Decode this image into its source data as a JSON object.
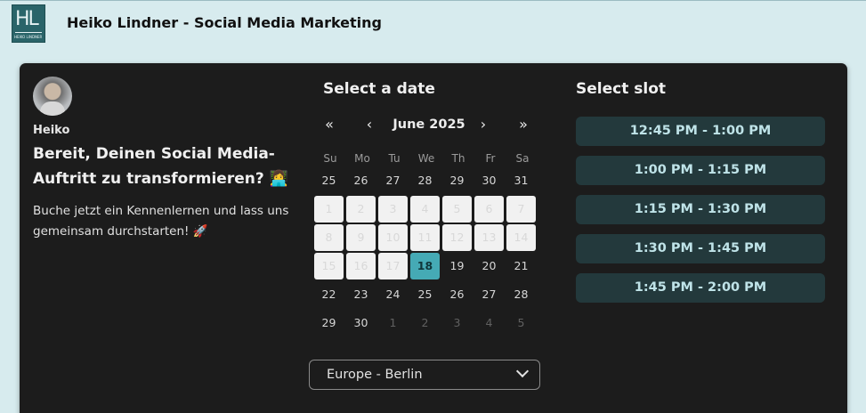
{
  "header": {
    "logo_letters": "HL",
    "logo_sub": "HEIKO LINDNER",
    "brand": "Heiko Lindner - Social Media Marketing"
  },
  "host": {
    "name": "Heiko",
    "title": "Bereit, Deinen Social Media-Auftritt zu transformieren? 👩‍💻",
    "description": "Buche jetzt ein Kennenlernen und lass uns gemeinsam durchstarten! 🚀"
  },
  "calendar": {
    "heading": "Select a date",
    "nav": {
      "prev_year": "«",
      "prev_month": "‹",
      "next_month": "›",
      "next_year": "»"
    },
    "month_label": "June 2025",
    "weekdays": [
      "Su",
      "Mo",
      "Tu",
      "We",
      "Th",
      "Fr",
      "Sa"
    ],
    "weeks": [
      [
        {
          "d": "25",
          "s": "normal"
        },
        {
          "d": "26",
          "s": "normal"
        },
        {
          "d": "27",
          "s": "normal"
        },
        {
          "d": "28",
          "s": "normal"
        },
        {
          "d": "29",
          "s": "normal"
        },
        {
          "d": "30",
          "s": "normal"
        },
        {
          "d": "31",
          "s": "normal"
        }
      ],
      [
        {
          "d": "1",
          "s": "disabled"
        },
        {
          "d": "2",
          "s": "disabled"
        },
        {
          "d": "3",
          "s": "disabled"
        },
        {
          "d": "4",
          "s": "disabled"
        },
        {
          "d": "5",
          "s": "disabled"
        },
        {
          "d": "6",
          "s": "disabled"
        },
        {
          "d": "7",
          "s": "disabled"
        }
      ],
      [
        {
          "d": "8",
          "s": "disabled"
        },
        {
          "d": "9",
          "s": "disabled"
        },
        {
          "d": "10",
          "s": "disabled"
        },
        {
          "d": "11",
          "s": "disabled"
        },
        {
          "d": "12",
          "s": "disabled"
        },
        {
          "d": "13",
          "s": "disabled"
        },
        {
          "d": "14",
          "s": "disabled"
        }
      ],
      [
        {
          "d": "15",
          "s": "disabled"
        },
        {
          "d": "16",
          "s": "disabled"
        },
        {
          "d": "17",
          "s": "disabled"
        },
        {
          "d": "18",
          "s": "selected"
        },
        {
          "d": "19",
          "s": "normal"
        },
        {
          "d": "20",
          "s": "normal"
        },
        {
          "d": "21",
          "s": "normal"
        }
      ],
      [
        {
          "d": "22",
          "s": "normal"
        },
        {
          "d": "23",
          "s": "normal"
        },
        {
          "d": "24",
          "s": "normal"
        },
        {
          "d": "25",
          "s": "normal"
        },
        {
          "d": "26",
          "s": "normal"
        },
        {
          "d": "27",
          "s": "normal"
        },
        {
          "d": "28",
          "s": "normal"
        }
      ],
      [
        {
          "d": "29",
          "s": "normal"
        },
        {
          "d": "30",
          "s": "normal"
        },
        {
          "d": "1",
          "s": "out"
        },
        {
          "d": "2",
          "s": "out"
        },
        {
          "d": "3",
          "s": "out"
        },
        {
          "d": "4",
          "s": "out"
        },
        {
          "d": "5",
          "s": "out"
        }
      ]
    ],
    "timezone": "Europe - Berlin"
  },
  "slots": {
    "heading": "Select slot",
    "items": [
      "12:45 PM - 1:00 PM",
      "1:00 PM - 1:15 PM",
      "1:15 PM - 1:30 PM",
      "1:30 PM - 1:45 PM",
      "1:45 PM - 2:00 PM"
    ]
  },
  "colors": {
    "page_bg": "#d7ebee",
    "panel_bg": "#1c1c1c",
    "accent": "#45aab5",
    "slot_bg": "#23393c"
  }
}
